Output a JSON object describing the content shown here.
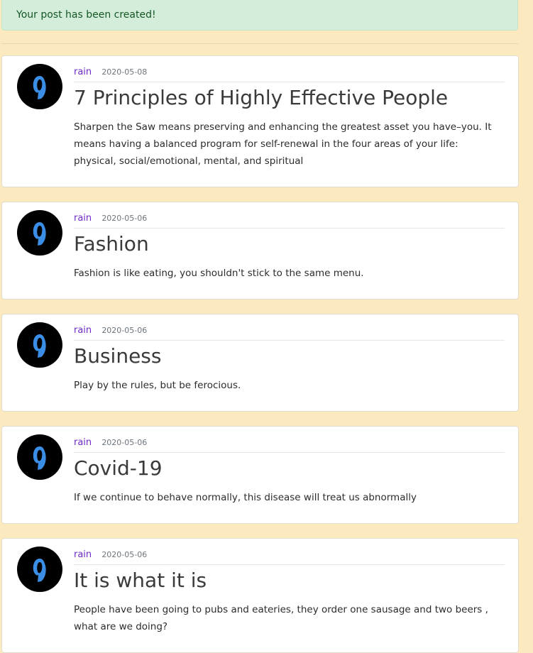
{
  "alert": {
    "message": "Your post has been created!"
  },
  "colors": {
    "background": "#fde9bf",
    "alert_bg": "#d4edda",
    "alert_text": "#155724",
    "author": "#6f2bc9",
    "avatar_accent": "#3b8ee6"
  },
  "posts": [
    {
      "author": "rain",
      "date": "2020-05-08",
      "title": "7 Principles of Highly Effective People",
      "content": "Sharpen the Saw means preserving and enhancing the greatest asset you have–you. It means having a balanced program for self-renewal in the four areas of your life: physical, social/emotional, mental, and spiritual",
      "avatar_icon": "user-avatar-icon"
    },
    {
      "author": "rain",
      "date": "2020-05-06",
      "title": "Fashion",
      "content": "Fashion is like eating, you shouldn't stick to the same menu.",
      "avatar_icon": "user-avatar-icon"
    },
    {
      "author": "rain",
      "date": "2020-05-06",
      "title": "Business",
      "content": "Play by the rules, but be ferocious.",
      "avatar_icon": "user-avatar-icon"
    },
    {
      "author": "rain",
      "date": "2020-05-06",
      "title": "Covid-19",
      "content": "If we continue to behave normally, this disease will treat us abnormally",
      "avatar_icon": "user-avatar-icon"
    },
    {
      "author": "rain",
      "date": "2020-05-06",
      "title": "It is what it is",
      "content": "People have been going to pubs and eateries, they order one sausage and two beers , what are we doing?",
      "avatar_icon": "user-avatar-icon"
    }
  ]
}
